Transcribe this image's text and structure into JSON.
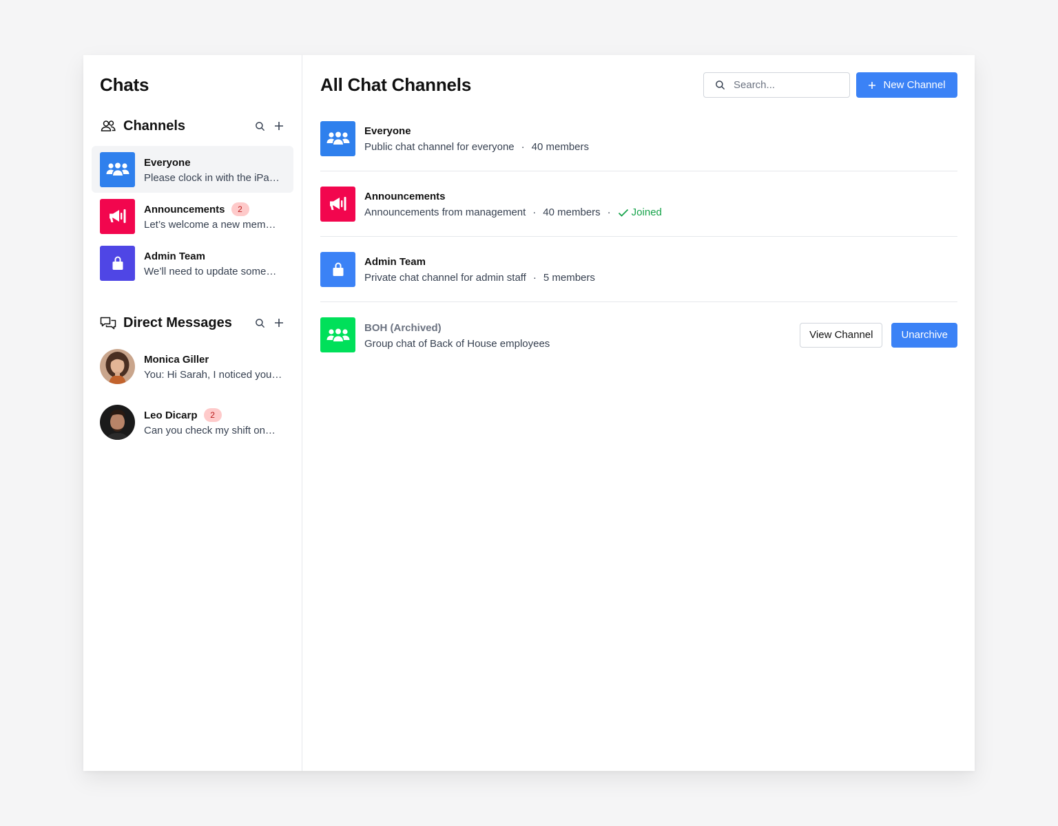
{
  "sidebar": {
    "title": "Chats",
    "channels_section": {
      "label": "Channels",
      "icon": "users-icon",
      "items": [
        {
          "name": "Everyone",
          "preview": "Please clock in with the iPa…",
          "color": "#2f80ed",
          "icon": "group-icon",
          "badge": null
        },
        {
          "name": "Announcements",
          "preview": "Let’s welcome a new mem…",
          "color": "#f2064e",
          "icon": "megaphone-icon",
          "badge": "2"
        },
        {
          "name": "Admin Team",
          "preview": "We’ll need to update some…",
          "color": "#4f46e5",
          "icon": "lock-icon",
          "badge": null
        }
      ]
    },
    "dm_section": {
      "label": "Direct Messages",
      "icon": "chat-bubbles-icon",
      "items": [
        {
          "name": "Monica Giller",
          "preview": "You: Hi Sarah, I noticed you…",
          "badge": null
        },
        {
          "name": "Leo Dicarp",
          "preview": "Can you check my shift on…",
          "badge": "2"
        }
      ]
    }
  },
  "main": {
    "title": "All Chat Channels",
    "search": {
      "placeholder": "Search..."
    },
    "new_channel_label": "New Channel",
    "channels": [
      {
        "name": "Everyone",
        "description": "Public chat channel for everyone",
        "members": "40 members",
        "color": "#2f80ed",
        "icon": "group-icon"
      },
      {
        "name": "Announcements",
        "description": "Announcements from management",
        "members": "40 members",
        "status": "Joined",
        "color": "#f2064e",
        "icon": "megaphone-icon"
      },
      {
        "name": "Admin Team",
        "description": "Private chat channel for admin staff",
        "members": "5 members",
        "color": "#3b82f6",
        "icon": "lock-icon"
      },
      {
        "name": "BOH (Archived)",
        "description": "Group chat of Back of House employees",
        "color": "#00e05a",
        "icon": "group-icon",
        "actions": {
          "view": "View Channel",
          "unarchive": "Unarchive"
        }
      }
    ],
    "dot_separator": "·"
  },
  "colors": {
    "accent": "#3b82f6",
    "badge_bg": "#fecaca",
    "badge_text": "#b91c1c",
    "joined": "#16a34a"
  }
}
